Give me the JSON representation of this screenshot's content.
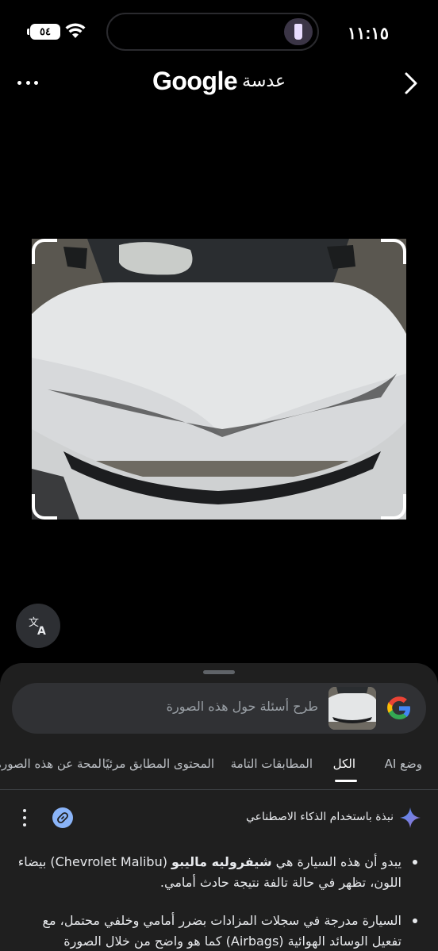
{
  "status_bar": {
    "time": "١١:١٥",
    "battery": "٥٤"
  },
  "header": {
    "brand": "Google",
    "product": "عدسة"
  },
  "search": {
    "placeholder": "طرح أسئلة حول هذه الصورة"
  },
  "tabs": [
    {
      "label": "وضع AI",
      "active": false
    },
    {
      "label": "الكل",
      "active": true
    },
    {
      "label": "المطابقات التامة",
      "active": false
    },
    {
      "label": "المحتوى المطابق مرئيًا",
      "active": false
    },
    {
      "label": "لمحة عن هذه الصورة",
      "active": false
    }
  ],
  "ai_overview": {
    "label": "نبذة باستخدام الذكاء الاصطناعي",
    "bullets": [
      {
        "pre": "يبدو أن هذه السيارة هي ",
        "bold": "شيفروليه ماليبو",
        "post": " (Chevrolet Malibu) بيضاء اللون، تظهر في حالة تالفة نتيجة حادث أمامي."
      },
      {
        "pre": "السيارة مدرجة في سجلات المزادات بضرر أمامي وخلفي محتمل، مع تفعيل الوسائد الهوائية (Airbags) كما هو واضح من خلال الصورة",
        "bold": "",
        "post": ""
      }
    ]
  },
  "colors": {
    "background": "#000000",
    "sheet": "#1f1f1f",
    "search_bar": "#303134",
    "accent_blue": "#8ab4f8"
  },
  "icons": {
    "more": "more-horizontal-icon",
    "back": "chevron-right-icon",
    "translate": "translate-icon",
    "google": "google-g-icon",
    "ai": "sparkle-icon",
    "link": "link-icon",
    "menu": "more-vertical-icon"
  }
}
